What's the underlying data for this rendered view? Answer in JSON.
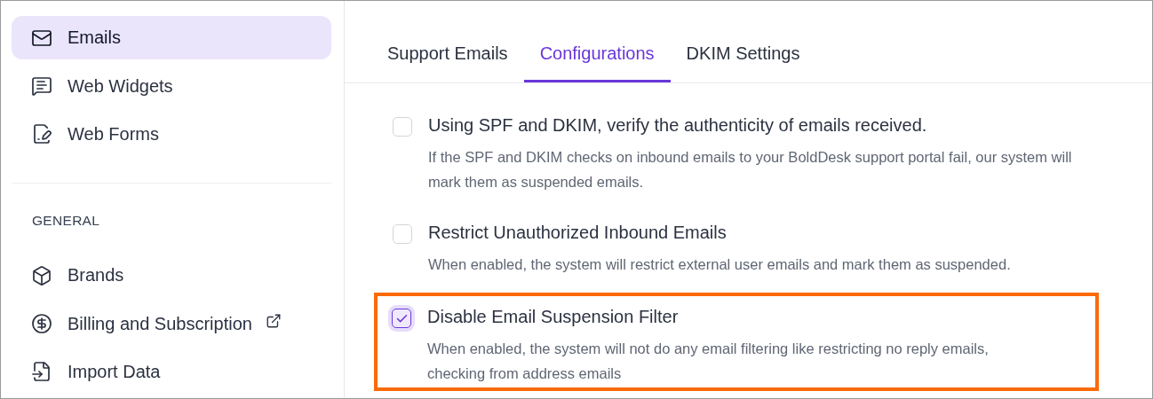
{
  "sidebar": {
    "groups": [
      {
        "items": [
          {
            "label": "Emails",
            "selected": true,
            "external": false
          },
          {
            "label": "Web Widgets",
            "selected": false,
            "external": false
          },
          {
            "label": "Web Forms",
            "selected": false,
            "external": false
          }
        ]
      },
      {
        "heading": "GENERAL",
        "items": [
          {
            "label": "Brands",
            "selected": false,
            "external": false
          },
          {
            "label": "Billing and Subscription",
            "selected": false,
            "external": true
          },
          {
            "label": "Import Data",
            "selected": false,
            "external": false
          }
        ]
      }
    ]
  },
  "tabs": [
    {
      "label": "Support Emails",
      "selected": false
    },
    {
      "label": "Configurations",
      "selected": true
    },
    {
      "label": "DKIM Settings",
      "selected": false
    }
  ],
  "options": [
    {
      "title": "Using SPF and DKIM, verify the authenticity of emails received.",
      "description": "If the SPF and DKIM checks on inbound emails to your BoldDesk support portal fail, our system will mark them as suspended emails.",
      "checked": false,
      "highlighted": false
    },
    {
      "title": "Restrict Unauthorized Inbound Emails",
      "description": "When enabled, the system will restrict external user emails and mark them as suspended.",
      "checked": false,
      "highlighted": false
    },
    {
      "title": "Disable Email Suspension Filter",
      "description": "When enabled, the system will not do any email filtering like restricting no reply emails, checking from address emails",
      "checked": true,
      "highlighted": true
    }
  ]
}
